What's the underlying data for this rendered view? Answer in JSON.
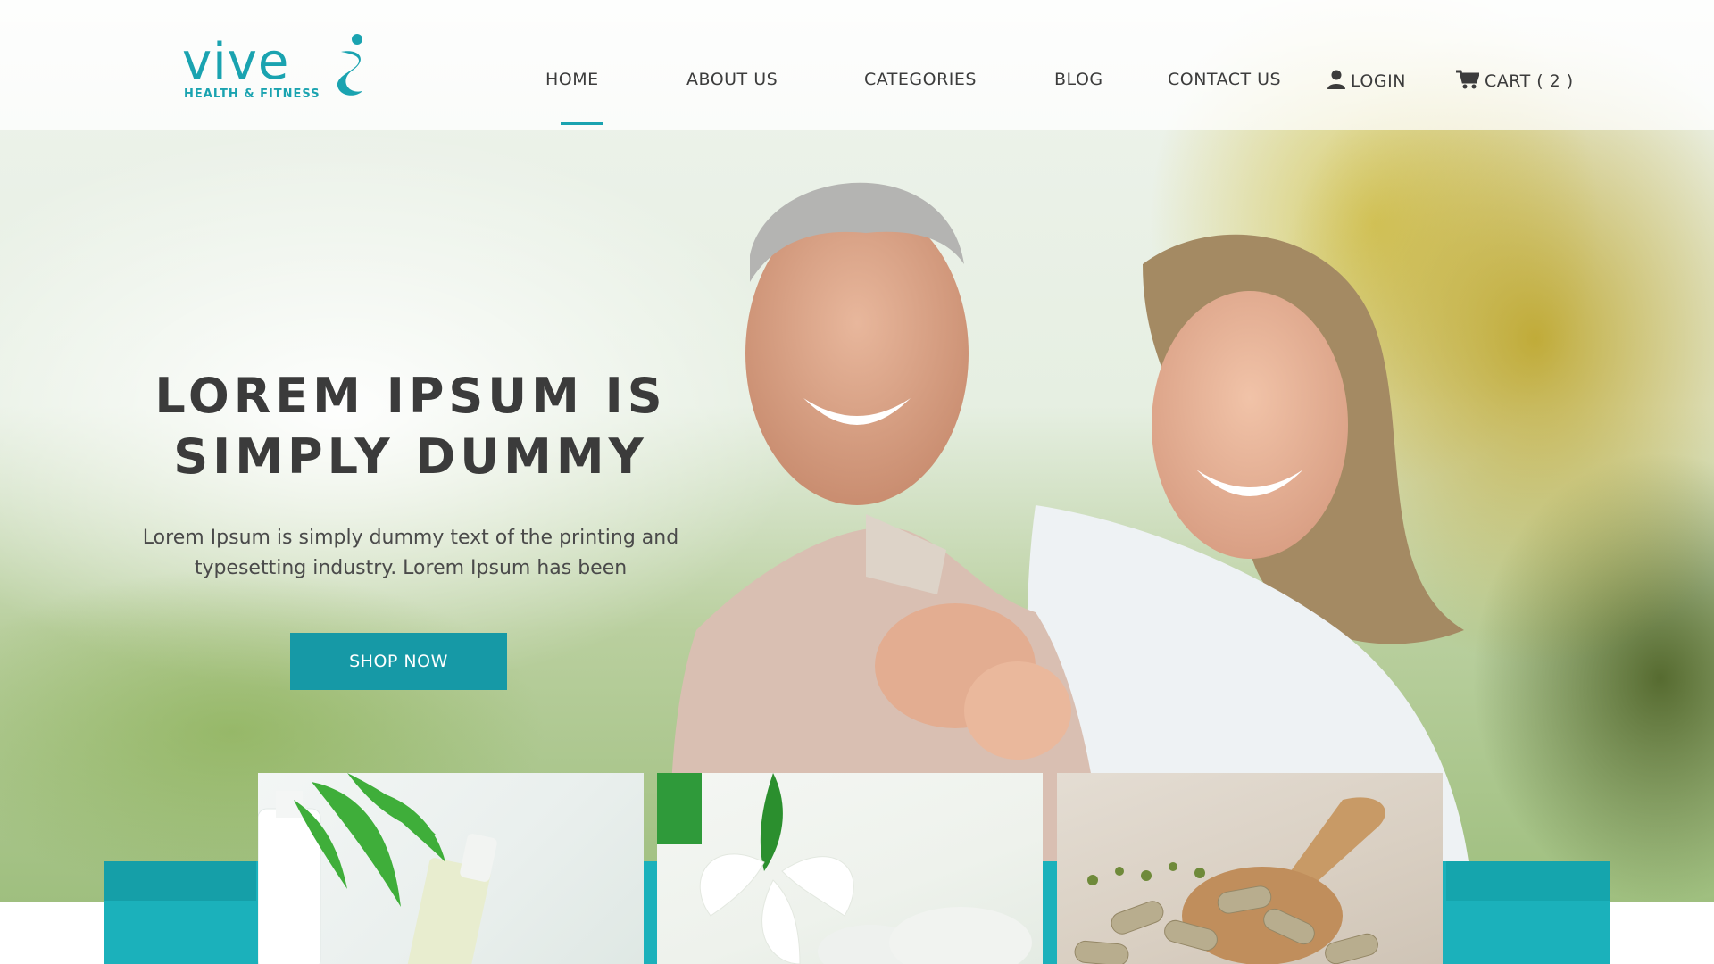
{
  "brand": {
    "name": "vive",
    "tagline": "HEALTH & FITNESS",
    "color": "#1aa3b0"
  },
  "nav": {
    "home": "HOME",
    "about": "ABOUT US",
    "categories": "CATEGORIES",
    "blog": "BLOG",
    "contact": "CONTACT US",
    "login": "LOGIN",
    "cart": "CART ( 2 )",
    "active": "HOME"
  },
  "hero": {
    "title": "LOREM IPSUM IS SIMPLY DUMMY",
    "description": "Lorem Ipsum is simply dummy text of the printing and typesetting industry. Lorem Ipsum has been",
    "cta": "SHOP NOW",
    "cta_color": "#1699a6"
  },
  "cards": [
    {
      "icon": "cosmetic-bottles-fern-image"
    },
    {
      "icon": "white-lily-flower-image"
    },
    {
      "icon": "herbal-capsules-spoon-image"
    }
  ],
  "icons": {
    "login": "user-icon",
    "cart": "cart-icon",
    "logo": "figure-swirl-icon"
  }
}
